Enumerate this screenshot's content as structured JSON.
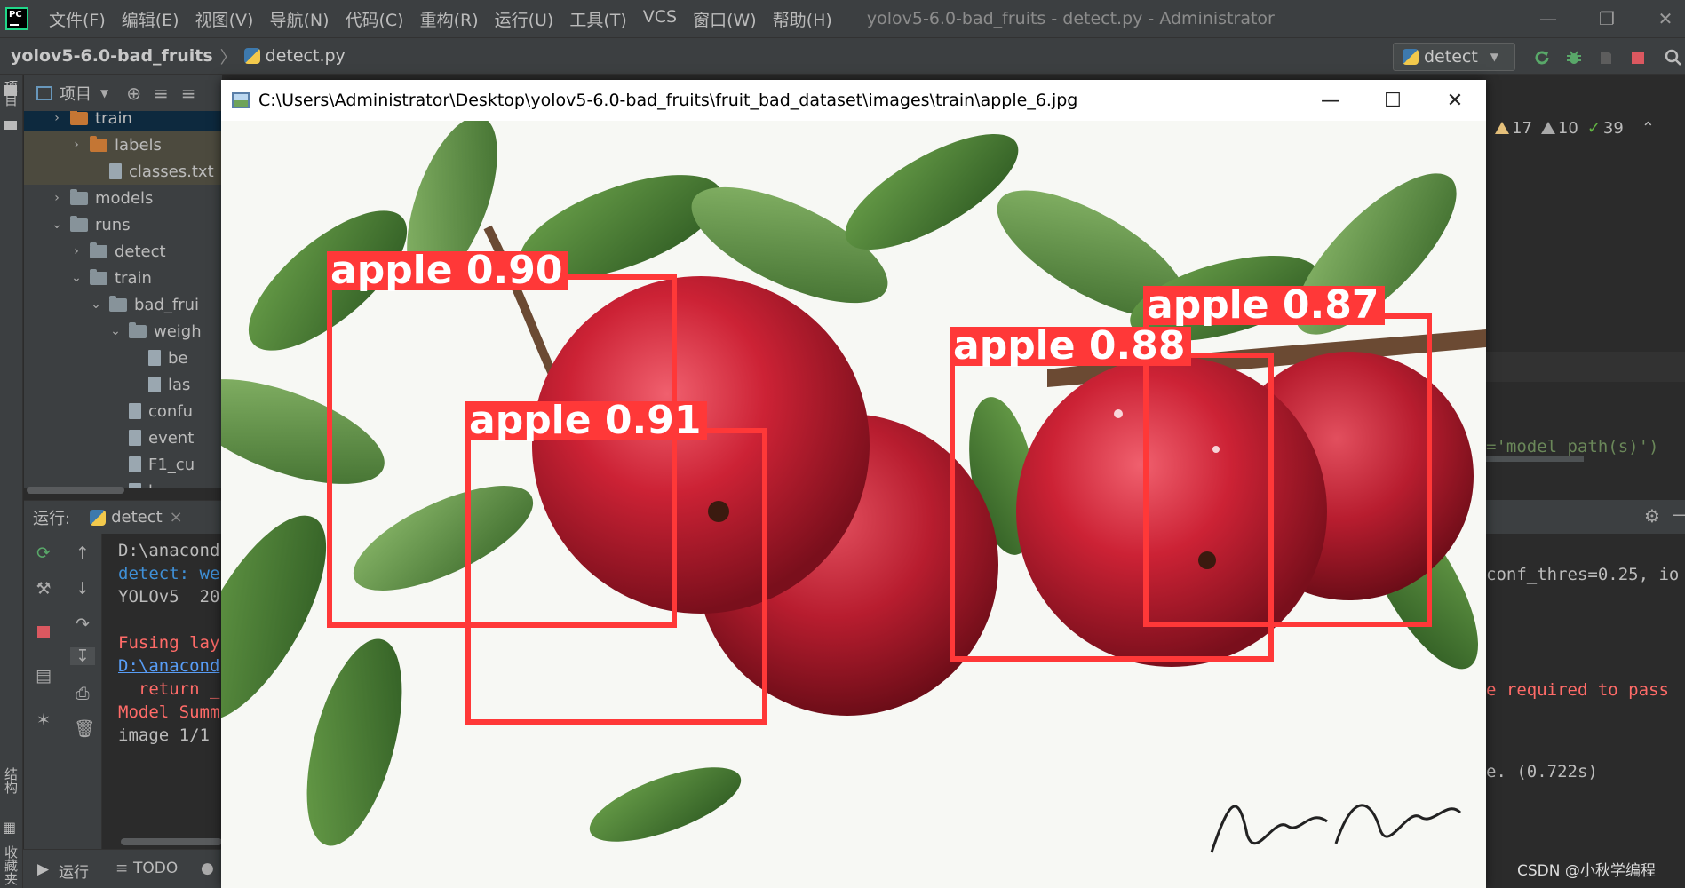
{
  "menubar": {
    "items": [
      "文件(F)",
      "编辑(E)",
      "视图(V)",
      "导航(N)",
      "代码(C)",
      "重构(R)",
      "运行(U)",
      "工具(T)",
      "VCS",
      "窗口(W)",
      "帮助(H)"
    ],
    "window_title": "yolov5-6.0-bad_fruits - detect.py - Administrator"
  },
  "navbar": {
    "project": "yolov5-6.0-bad_fruits",
    "separator": "〉",
    "file": "detect.py",
    "run_config": "detect"
  },
  "left_strip": {
    "project_label": "项目",
    "structure_label": "结构",
    "favorites_label": "收藏夹"
  },
  "project_panel": {
    "title": "项目",
    "tree": [
      {
        "label": "train",
        "arrow": "›",
        "kind": "folder-orange",
        "indent": 0,
        "state": "sel"
      },
      {
        "label": "labels",
        "arrow": "›",
        "kind": "folder-orange",
        "indent": 1,
        "state": "hl"
      },
      {
        "label": "classes.txt",
        "arrow": "",
        "kind": "file",
        "indent": 2,
        "state": "hl"
      },
      {
        "label": "models",
        "arrow": "›",
        "kind": "folder",
        "indent": 0,
        "state": ""
      },
      {
        "label": "runs",
        "arrow": "⌄",
        "kind": "folder",
        "indent": 0,
        "state": ""
      },
      {
        "label": "detect",
        "arrow": "›",
        "kind": "folder",
        "indent": 1,
        "state": ""
      },
      {
        "label": "train",
        "arrow": "⌄",
        "kind": "folder",
        "indent": 1,
        "state": ""
      },
      {
        "label": "bad_frui",
        "arrow": "⌄",
        "kind": "folder",
        "indent": 2,
        "state": ""
      },
      {
        "label": "weigh",
        "arrow": "⌄",
        "kind": "folder",
        "indent": 3,
        "state": ""
      },
      {
        "label": "be",
        "arrow": "",
        "kind": "file",
        "indent": 4,
        "state": ""
      },
      {
        "label": "las",
        "arrow": "",
        "kind": "file",
        "indent": 4,
        "state": ""
      },
      {
        "label": "confu",
        "arrow": "",
        "kind": "file",
        "indent": 3,
        "state": ""
      },
      {
        "label": "event",
        "arrow": "",
        "kind": "file",
        "indent": 3,
        "state": ""
      },
      {
        "label": "F1_cu",
        "arrow": "",
        "kind": "file",
        "indent": 3,
        "state": ""
      },
      {
        "label": "hyp.ya",
        "arrow": "",
        "kind": "file",
        "indent": 3,
        "state": ""
      }
    ]
  },
  "run_panel": {
    "label": "运行:",
    "tab": "detect",
    "tab_close": "×",
    "console": [
      {
        "text": "D:\\anacond",
        "color": "#bbbbbb",
        "underline": false
      },
      {
        "text": "detect: we",
        "color": "#3f8fd6",
        "underline": false,
        "bold_prefix": "detect:"
      },
      {
        "text": "YOLOv5  20",
        "color": "#bbbbbb",
        "underline": false
      },
      {
        "text": "",
        "color": "#bbbbbb",
        "underline": false
      },
      {
        "text": "Fusing lay",
        "color": "#ff6b68",
        "underline": false
      },
      {
        "text": "D:\\anacond",
        "color": "#589df6",
        "underline": true
      },
      {
        "text": "  return _",
        "color": "#ff6b68",
        "underline": false
      },
      {
        "text": "Model Summ",
        "color": "#ff6b68",
        "underline": false
      },
      {
        "text": "image 1/1 ",
        "color": "#bbbbbb",
        "underline": false
      }
    ]
  },
  "statusbar": {
    "run_tab": "运行",
    "todo_tab": "TODO"
  },
  "right_side": {
    "warnings": "17",
    "weak_warnings": "10",
    "ok_count": "39",
    "code_fragment": "='model path(s)')",
    "console_right": [
      "conf_thres=0.25, io",
      "e required to pass",
      "e. (0.722s)"
    ],
    "watermark": "CSDN @小秋学编程"
  },
  "image_window": {
    "title": "C:\\Users\\Administrator\\Desktop\\yolov5-6.0-bad_fruits\\fruit_bad_dataset\\images\\train\\apple_6.jpg",
    "detections": [
      {
        "label": "apple 0.90"
      },
      {
        "label": "apple 0.91"
      },
      {
        "label": "apple 0.88"
      },
      {
        "label": "apple 0.87"
      }
    ]
  },
  "colors": {
    "ide_bg": "#2b2b2b",
    "ide_panel": "#3c3f41",
    "bbox": "#ff3838"
  }
}
